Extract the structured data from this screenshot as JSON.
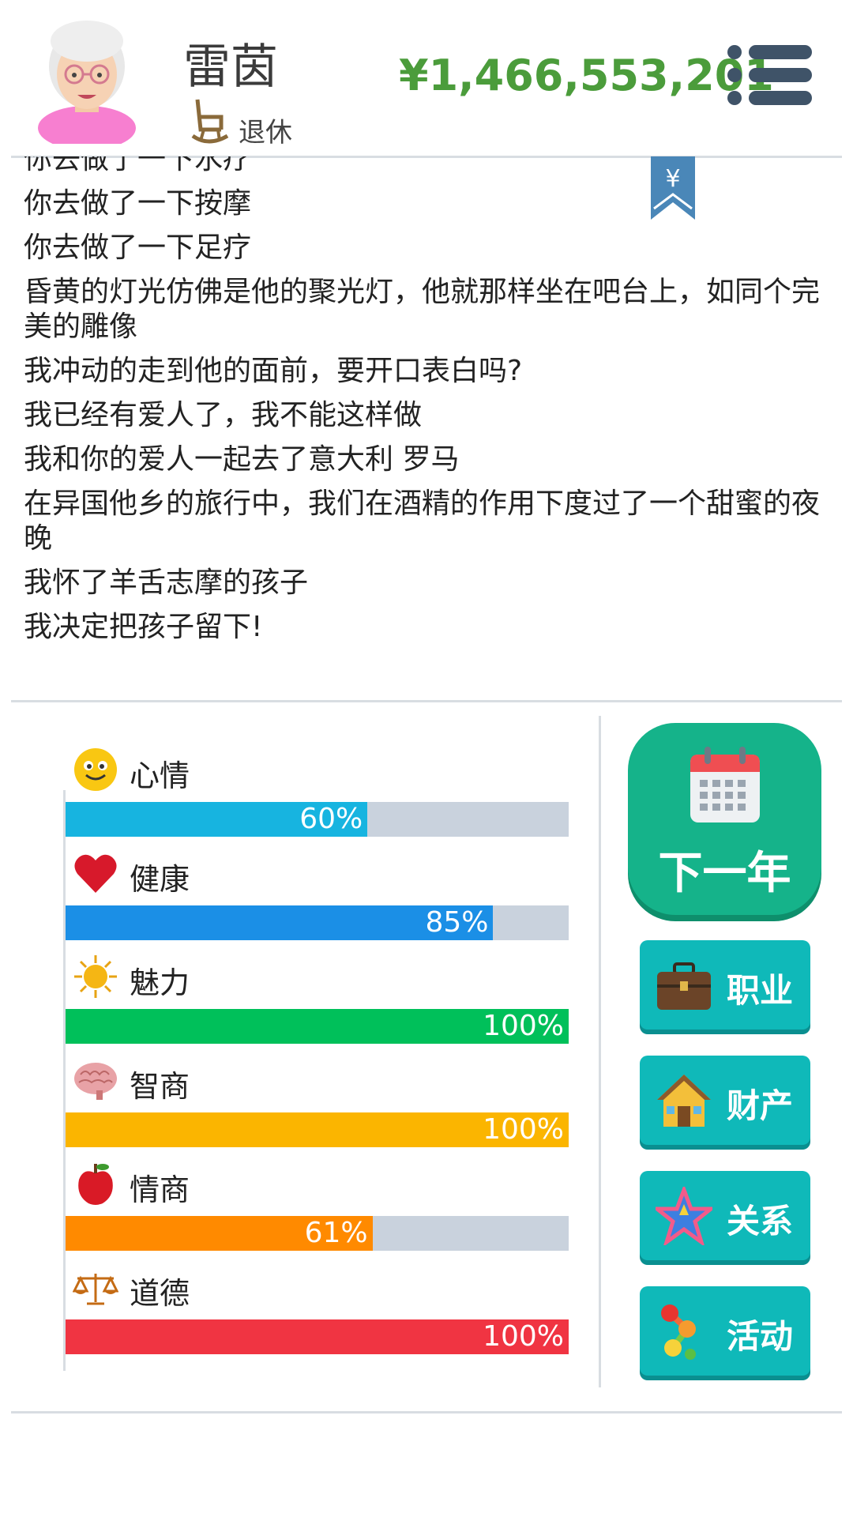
{
  "player": {
    "name": "雷茵",
    "status": "退休",
    "money": "¥1,466,553,201"
  },
  "log": [
    "你去做了一下水疗",
    "你去做了一下按摩",
    "你去做了一下足疗",
    "昏黄的灯光仿佛是他的聚光灯，他就那样坐在吧台上，如同个完美的雕像",
    "我冲动的走到他的面前，要开口表白吗?",
    "我已经有爱人了，我不能这样做",
    "我和你的爱人一起去了意大利 罗马",
    "在异国他乡的旅行中，我们在酒精的作用下度过了一个甜蜜的夜晚",
    "我怀了羊舌志摩的孩子",
    "我决定把孩子留下!"
  ],
  "bookmark": {
    "symbol": "¥",
    "icon": "bookmark-yen-icon"
  },
  "stats": [
    {
      "label": "心情",
      "value": 60,
      "pct": "60%",
      "color": "#17b4e0",
      "icon": "smiley-icon"
    },
    {
      "label": "健康",
      "value": 85,
      "pct": "85%",
      "color": "#1b8fe6",
      "icon": "heart-icon"
    },
    {
      "label": "魅力",
      "value": 100,
      "pct": "100%",
      "color": "#00c05a",
      "icon": "sun-icon"
    },
    {
      "label": "智商",
      "value": 100,
      "pct": "100%",
      "color": "#fbb500",
      "icon": "brain-icon"
    },
    {
      "label": "情商",
      "value": 61,
      "pct": "61%",
      "color": "#ff8a00",
      "icon": "apple-icon"
    },
    {
      "label": "道德",
      "value": 100,
      "pct": "100%",
      "color": "#f03442",
      "icon": "scales-icon"
    }
  ],
  "actions": {
    "next_year": "下一年",
    "career": "职业",
    "assets": "财产",
    "relations": "关系",
    "activities": "活动"
  },
  "colors": {
    "money": "#4b9c3b",
    "next_year_button": "#15b38a",
    "side_button": "#0fb9b9",
    "track": "#c9d2dd"
  }
}
